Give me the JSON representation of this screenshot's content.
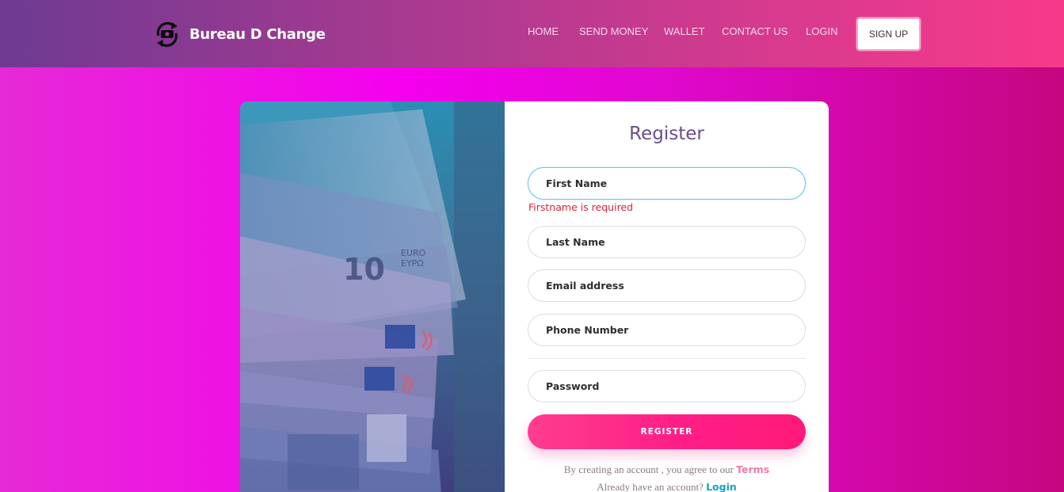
{
  "brand": {
    "name": "Bureau D Change",
    "logo_icon": "currency-exchange-icon"
  },
  "nav": {
    "items": [
      {
        "label": "HOME"
      },
      {
        "label": "SEND MONEY"
      },
      {
        "label": "WALLET"
      },
      {
        "label": "CONTACT US"
      },
      {
        "label": "LOGIN"
      }
    ],
    "signup_label": "SIGN UP"
  },
  "image": {
    "caption": "10 EURO ΕΥΡΩ"
  },
  "form": {
    "title": "Register",
    "first_name": {
      "placeholder": "First Name",
      "value": ""
    },
    "first_name_error": "Firstname is required",
    "last_name": {
      "placeholder": "Last Name"
    },
    "email": {
      "placeholder": "Email address"
    },
    "phone": {
      "placeholder": "Phone Number"
    },
    "password": {
      "placeholder": "Password"
    },
    "submit_label": "REGISTER",
    "terms_text": "By creating an account , you agree to our ",
    "terms_link": "Terms",
    "login_text": "Already have an account? ",
    "login_link": "Login"
  },
  "colors": {
    "accent_pink": "#ff1e86",
    "link_teal": "#1aa3c4",
    "error_red": "#d9253a",
    "title_purple": "#6a4d8c"
  }
}
